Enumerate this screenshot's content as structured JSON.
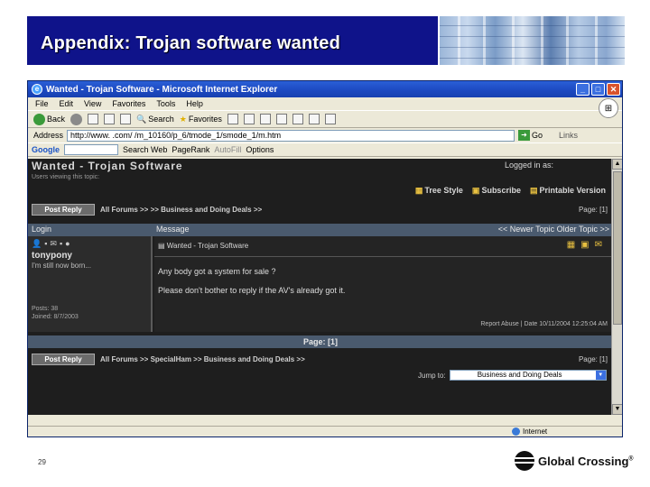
{
  "slide": {
    "title": "Appendix: Trojan software wanted",
    "page_number": "29",
    "logo_text": "Global Crossing",
    "logo_trademark": "®"
  },
  "browser": {
    "window_title": "Wanted - Trojan Software - Microsoft Internet Explorer",
    "window_buttons": [
      "_",
      "□",
      "✕"
    ],
    "menu": [
      "File",
      "Edit",
      "View",
      "Favorites",
      "Tools",
      "Help"
    ],
    "toolbar": {
      "back": "Back",
      "search": "Search",
      "favorites": "Favorites"
    },
    "address": {
      "label": "Address",
      "url": "http://www.            .com/               /m_10160/p_6/tmode_1/smode_1/m.htm",
      "go": "Go",
      "links": "Links"
    },
    "googlebar": {
      "logo": "Google",
      "search_web": "Search Web",
      "pagerank": "PageRank",
      "autofill": "AutoFill",
      "options": "Options"
    },
    "status": {
      "zone": "Internet"
    }
  },
  "forum": {
    "title": "Wanted - Trojan Software",
    "logged_in": "Logged in as:",
    "users_viewing": "Users viewing this topic:",
    "links": [
      "Tree Style",
      "Subscribe",
      "Printable Version"
    ],
    "top_nav": {
      "post_reply": "Post Reply",
      "crumbs": "All Forums >>                              >> Business and Doing Deals >>",
      "page": "Page: [1]"
    },
    "header": {
      "login": "Login",
      "message": "Message",
      "nav": "<< Newer Topic   Older Topic >>"
    },
    "post": {
      "username": "tonypony",
      "user_title": "I'm still now born...",
      "posts": "Posts: 38",
      "joined": "Joined: 8/7/2003",
      "subject": "Wanted - Trojan Software",
      "line1": "Any body got a system for sale ?",
      "line2": "Please don't bother to reply if the AV's already got it.",
      "footer": "Report Abuse  |   Date 10/11/2004 12:25:04 AM"
    },
    "page_band": "Page:  [1]",
    "bottom_nav": {
      "post_reply": "Post Reply",
      "crumbs": "All Forums >> SpecialHam >> Business and Doing Deals >>",
      "page": "Page: [1]"
    },
    "jump": {
      "label": "Jump to:",
      "selected": "Business and Doing Deals"
    }
  }
}
